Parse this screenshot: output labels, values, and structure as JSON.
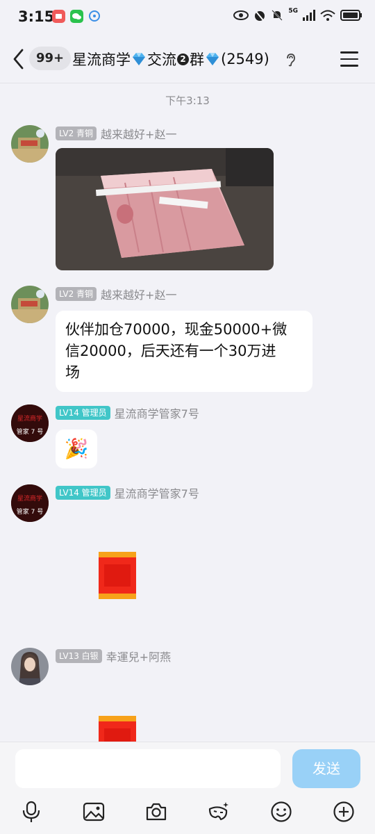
{
  "status_bar": {
    "time": "3:15",
    "network": "5G",
    "icons": [
      "eye-icon",
      "alarm-icon",
      "mute-icon",
      "signal-icon",
      "wifi-icon",
      "battery-icon"
    ]
  },
  "header": {
    "unread_count": "99+",
    "title_part1": "星流商学",
    "title_part2": "交流",
    "title_circled_num": "2",
    "title_part3": "群",
    "member_count": "(2549)"
  },
  "chat": {
    "time_divider": "下午3:13",
    "messages": [
      {
        "level": "LV2 青铜",
        "sender": "越来越好+赵一",
        "type": "image"
      },
      {
        "level": "LV2 青铜",
        "sender": "越来越好+赵一",
        "type": "text",
        "lines": [
          "伙伴加仓70000，现金50000+微",
          "信20000，后天还有一个30万进",
          "场"
        ]
      },
      {
        "level": "LV14 管理员",
        "sender": "星流商学管家7号",
        "type": "emoji",
        "emoji": "🎉"
      },
      {
        "level": "LV14 管理员",
        "sender": "星流商学管家7号",
        "type": "red-packet"
      },
      {
        "level": "LV13 白银",
        "sender": "幸運兒+阿燕",
        "type": "red-packet"
      }
    ],
    "avatar_text": {
      "line1": "星流商学",
      "line2": "管家 7 号"
    }
  },
  "input": {
    "placeholder": "",
    "send_label": "发送"
  },
  "colors": {
    "accent_teal": "#41c6c8",
    "send_button": "#99d1f7",
    "background": "#f2f2f7"
  }
}
